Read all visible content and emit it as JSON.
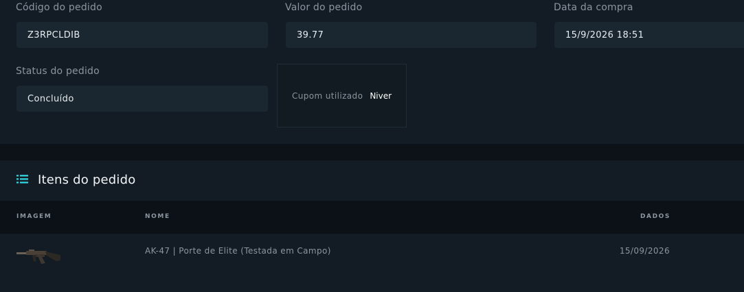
{
  "order": {
    "code_label": "Código do pedido",
    "code_value": "Z3RPCLDIB",
    "value_label": "Valor do pedido",
    "value_value": "39.77",
    "date_label": "Data da compra",
    "date_value": "15/9/2026 18:51",
    "status_label": "Status do pedido",
    "status_value": "Concluído",
    "coupon_label": "Cupom utilizado",
    "coupon_value": "Niver"
  },
  "items": {
    "title": "Itens do pedido",
    "title_icon": "list-icon",
    "accent_color": "#2ec6cf",
    "columns": {
      "image": "IMAGEM",
      "name": "NOME",
      "data": "DADOS"
    },
    "rows": [
      {
        "image_icon": "rifle-icon",
        "name": "AK-47 | Porte de Elite (Testada em Campo)",
        "date": "15/09/2026"
      }
    ]
  }
}
